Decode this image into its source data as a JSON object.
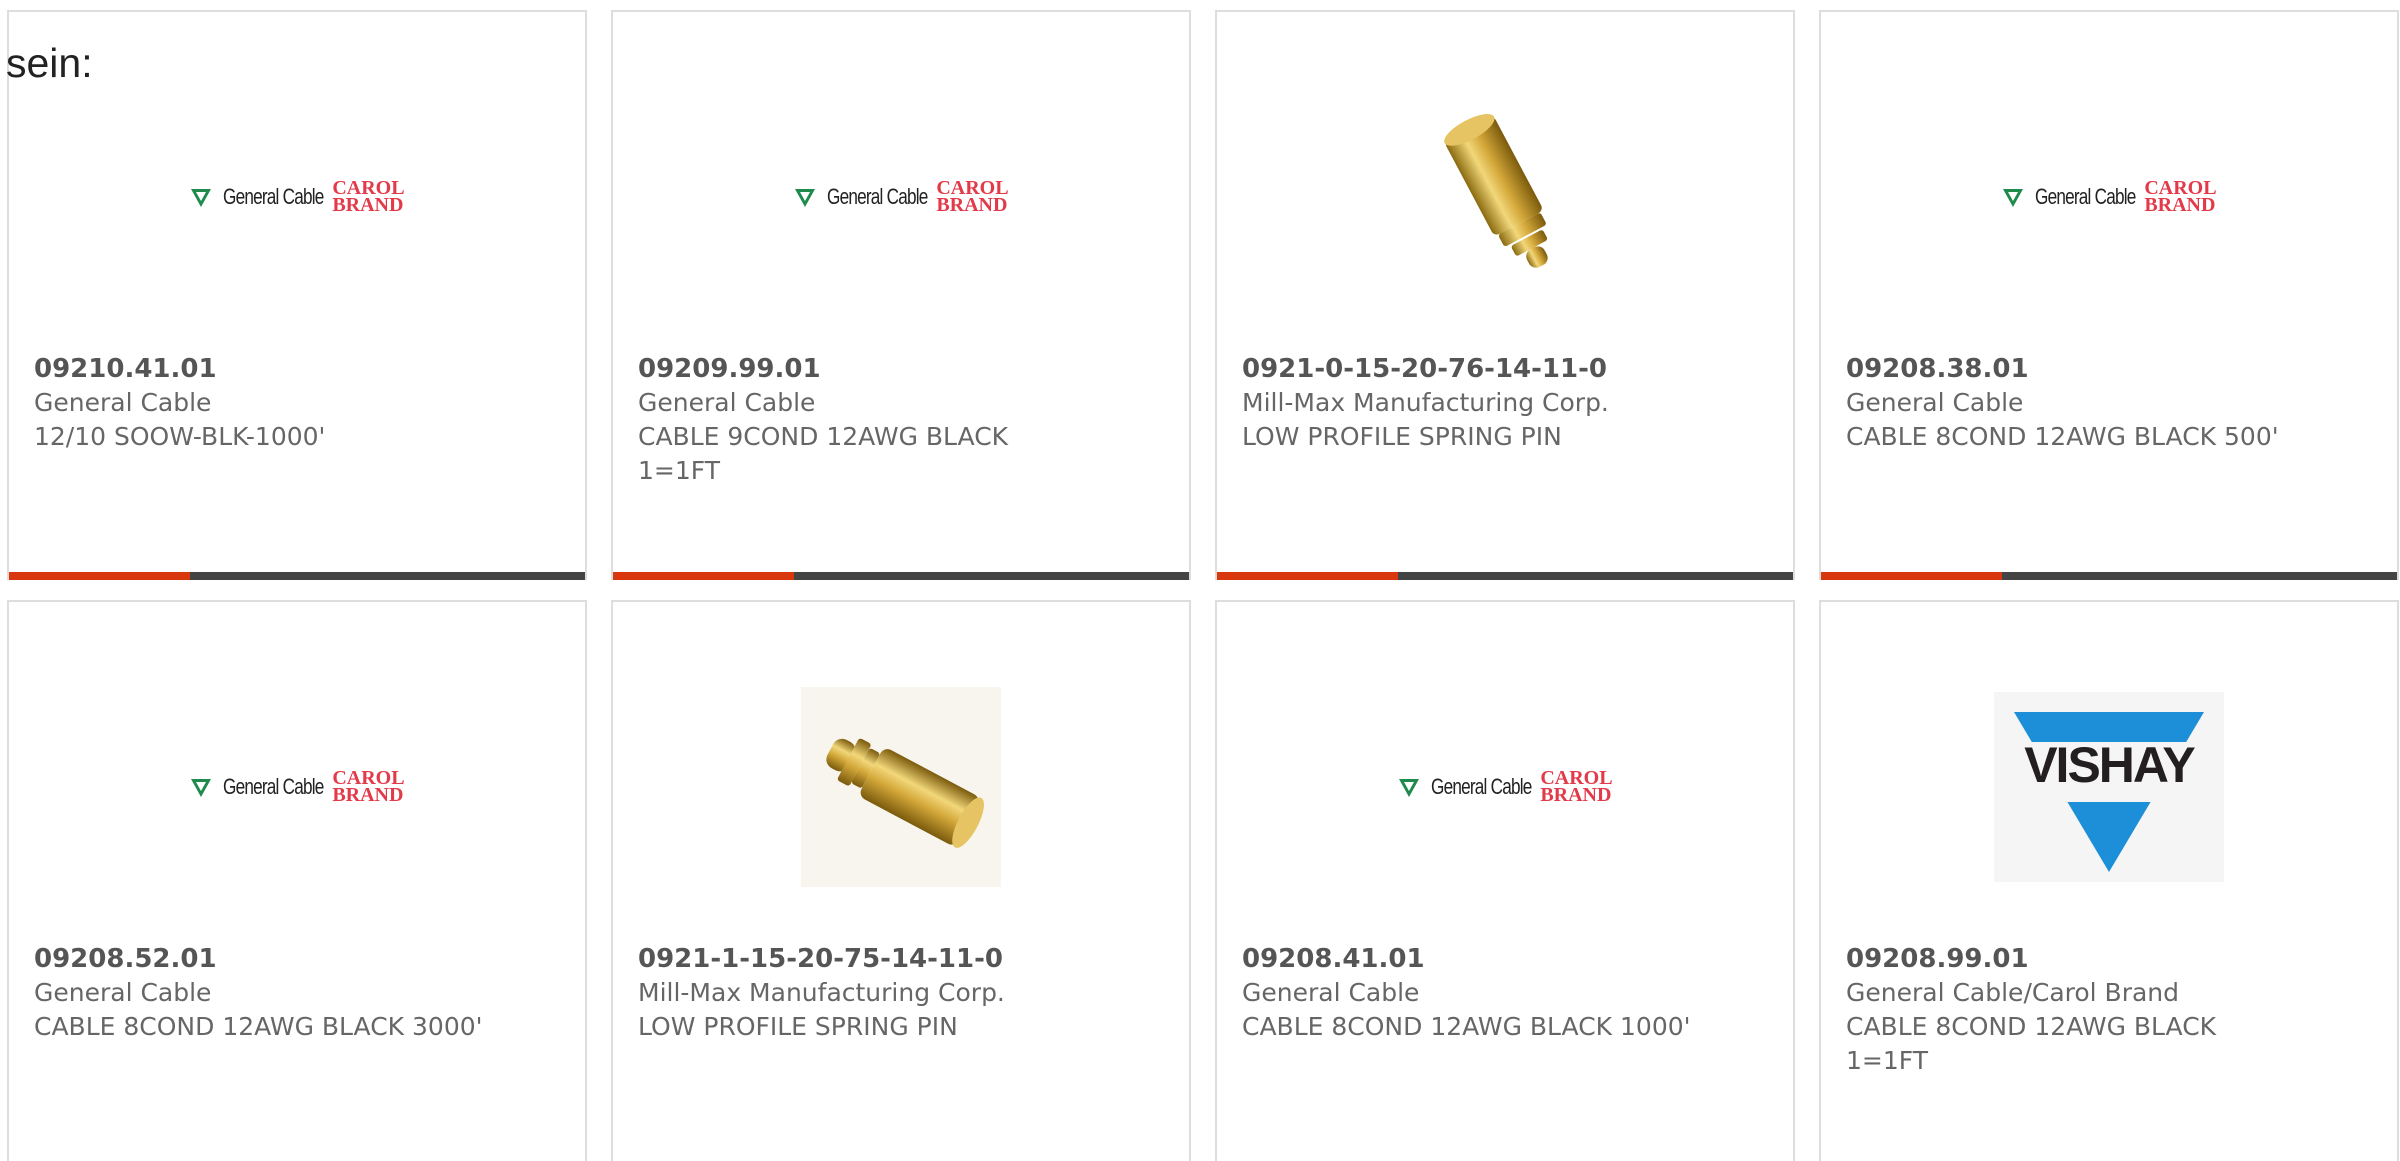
{
  "intro_text": "sein:",
  "colors": {
    "accent_orange": "#d9380f",
    "accent_dark": "#444444",
    "carol_red": "#e33a4a",
    "vishay_blue": "#1d8fd8"
  },
  "logo_text": {
    "general_cable": "General Cable",
    "carol": "CAROL",
    "brand": "BRAND",
    "vishay": "VISHAY"
  },
  "products": [
    {
      "part_number": "09210.41.01",
      "manufacturer": "General Cable",
      "description": "12/10 SOOW-BLK-1000'",
      "image": "general-cable-carol-brand-logo",
      "progress": 0.315
    },
    {
      "part_number": "09209.99.01",
      "manufacturer": "General Cable",
      "description": "CABLE 9COND 12AWG BLACK 1=1FT",
      "image": "general-cable-carol-brand-logo",
      "progress": 0.315
    },
    {
      "part_number": "0921-0-15-20-76-14-11-0",
      "manufacturer": "Mill-Max Manufacturing Corp.",
      "description": "LOW PROFILE SPRING PIN",
      "image": "gold-spring-pin-photo",
      "progress": 0.315
    },
    {
      "part_number": "09208.38.01",
      "manufacturer": "General Cable",
      "description": "CABLE 8COND 12AWG BLACK 500'",
      "image": "general-cable-carol-brand-logo",
      "progress": 0.315
    },
    {
      "part_number": "09208.52.01",
      "manufacturer": "General Cable",
      "description": "CABLE 8COND 12AWG BLACK 3000'",
      "image": "general-cable-carol-brand-logo"
    },
    {
      "part_number": "0921-1-15-20-75-14-11-0",
      "manufacturer": "Mill-Max Manufacturing Corp.",
      "description": "LOW PROFILE SPRING PIN",
      "image": "gold-spring-pin-photo"
    },
    {
      "part_number": "09208.41.01",
      "manufacturer": "General Cable",
      "description": "CABLE 8COND 12AWG BLACK 1000'",
      "image": "general-cable-carol-brand-logo"
    },
    {
      "part_number": "09208.99.01",
      "manufacturer": "General Cable/Carol Brand",
      "description": "CABLE 8COND 12AWG BLACK 1=1FT",
      "image": "vishay-logo"
    }
  ]
}
